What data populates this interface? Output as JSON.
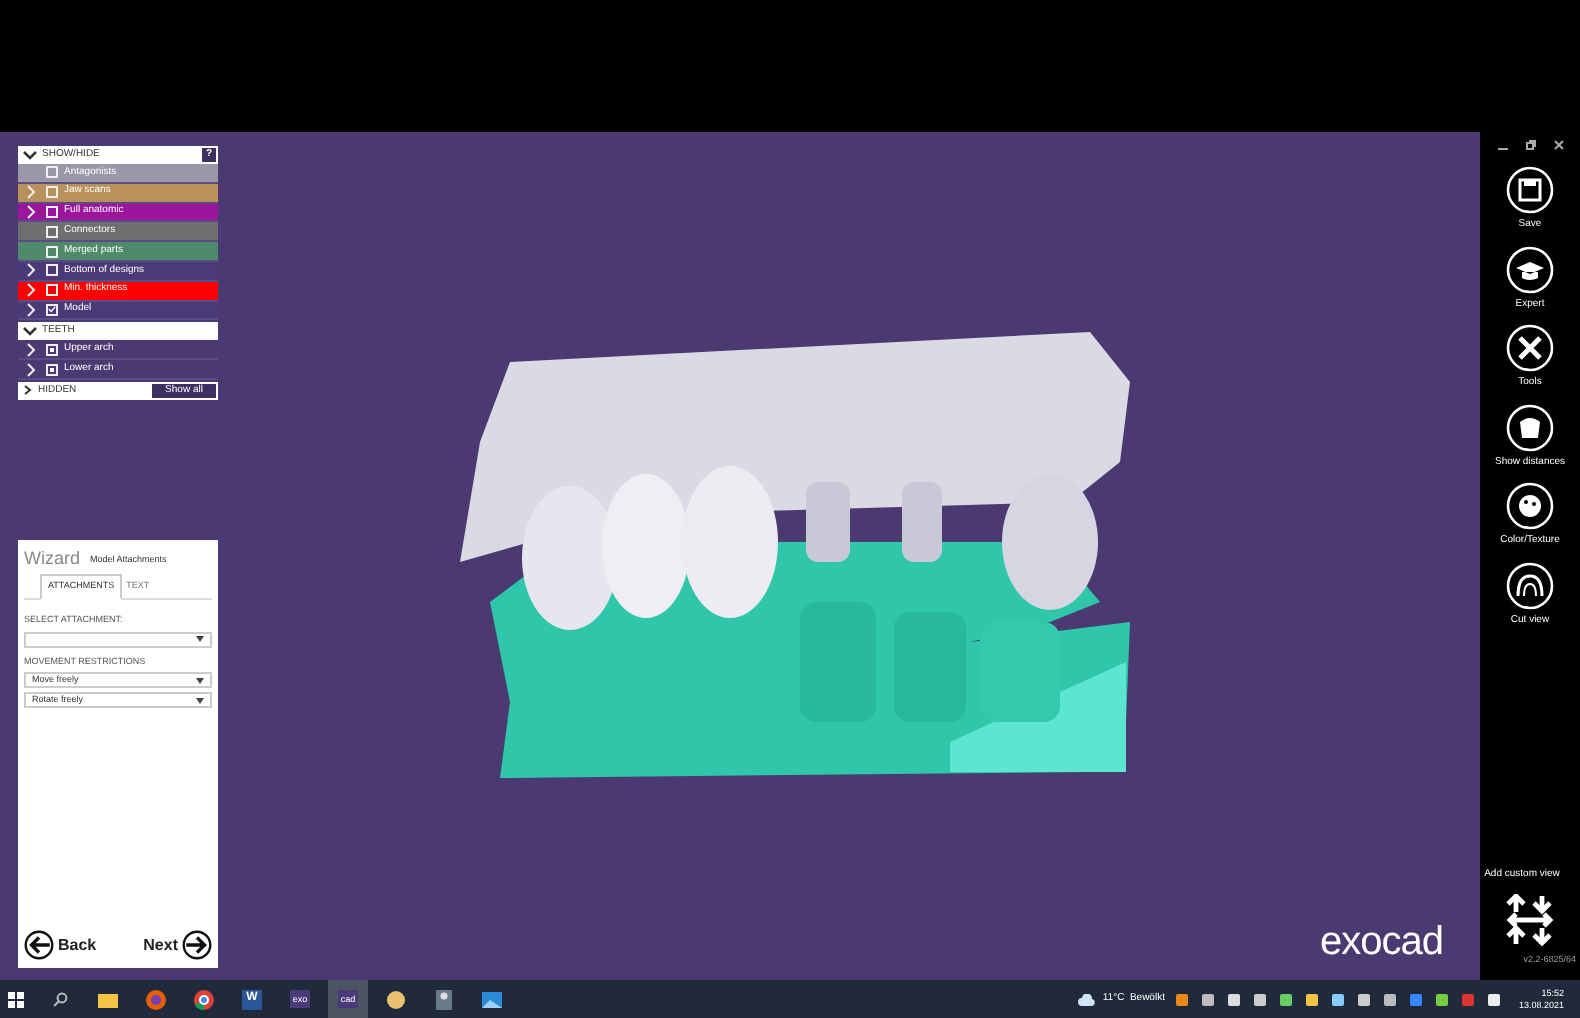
{
  "show_hide": {
    "title": "SHOW/HIDE",
    "help": "?",
    "items": [
      {
        "label": "Antagonists",
        "checked": false,
        "expandable": false,
        "color": "#9a98a8"
      },
      {
        "label": "Jaw scans",
        "checked": false,
        "expandable": true,
        "color": "#b8925a"
      },
      {
        "label": "Full anatomic",
        "checked": false,
        "expandable": true,
        "color": "#9b169b"
      },
      {
        "label": "Connectors",
        "checked": false,
        "expandable": false,
        "color": "#6f6f6f"
      },
      {
        "label": "Merged parts",
        "checked": false,
        "expandable": false,
        "color": "#4f8a6a"
      },
      {
        "label": "Bottom of designs",
        "checked": false,
        "expandable": true,
        "color": "#4b3a78"
      },
      {
        "label": "Min. thickness",
        "checked": false,
        "expandable": true,
        "color": "#ff0000"
      },
      {
        "label": "Model",
        "checked": true,
        "expandable": true,
        "color": "#4b3a78"
      }
    ]
  },
  "teeth": {
    "title": "TEETH",
    "items": [
      {
        "label": "Upper arch",
        "checked": true,
        "expandable": true
      },
      {
        "label": "Lower arch",
        "checked": true,
        "expandable": true
      }
    ]
  },
  "hidden": {
    "title": "HIDDEN",
    "button": "Show all"
  },
  "wizard": {
    "title": "Wizard",
    "subtitle": "Model Attachments",
    "tabs": [
      {
        "label": "ATTACHMENTS",
        "selected": true
      },
      {
        "label": "TEXT",
        "selected": false
      }
    ],
    "select_label": "SELECT ATTACHMENT:",
    "restrictions_label": "MOVEMENT RESTRICTIONS",
    "dropdowns": [
      "Move freely",
      "Rotate freely"
    ],
    "back": "Back",
    "next": "Next"
  },
  "toolbar": {
    "tools": [
      {
        "kind": "save",
        "label": "Save"
      },
      {
        "kind": "expert",
        "label": "Expert"
      },
      {
        "kind": "tools",
        "label": "Tools"
      },
      {
        "kind": "distances",
        "label": "Show distances"
      },
      {
        "kind": "color",
        "label": "Color/Texture"
      },
      {
        "kind": "cut",
        "label": "Cut view"
      }
    ],
    "custom_view": "Add custom view",
    "version": "v2.2-6825/64"
  },
  "logo": "exocad",
  "taskbar": {
    "apps": [
      {
        "kind": "folder"
      },
      {
        "kind": "firefox"
      },
      {
        "kind": "chrome"
      },
      {
        "kind": "word",
        "label": "W"
      },
      {
        "kind": "text",
        "label": "exo",
        "selected": false
      },
      {
        "kind": "text",
        "label": "cad",
        "selected": true
      },
      {
        "kind": "round"
      },
      {
        "kind": "person"
      },
      {
        "kind": "photo"
      }
    ],
    "weather": "11°C  Bewölkt",
    "time": "15:52",
    "date": "13.08.2021"
  }
}
